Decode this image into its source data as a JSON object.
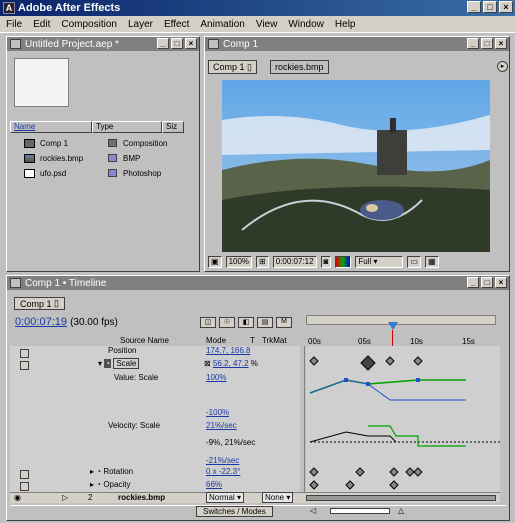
{
  "app": {
    "title": "Adobe After Effects"
  },
  "menu": [
    "File",
    "Edit",
    "Composition",
    "Layer",
    "Effect",
    "Animation",
    "View",
    "Window",
    "Help"
  ],
  "project": {
    "title": "Untitled Project.aep *",
    "columns": [
      "Name",
      "Type",
      "Siz"
    ],
    "items": [
      {
        "name": "Comp 1",
        "type": "Composition",
        "icon": "composition-icon",
        "color": "#707070"
      },
      {
        "name": "rockies.bmp",
        "type": "BMP",
        "icon": "footage-icon",
        "color": "#8888d0"
      },
      {
        "name": "ufo.psd",
        "type": "Photoshop",
        "icon": "psd-icon",
        "color": "#8888d0"
      }
    ]
  },
  "comp": {
    "title": "Comp 1",
    "tabs": [
      "Comp 1",
      "rockies.bmp"
    ],
    "zoom": "100%",
    "timecode": "0:00:07:12",
    "resolution": "Full"
  },
  "timeline": {
    "title": "Comp 1 • Timeline",
    "tab": "Comp 1",
    "timecode": "0:00:07:19",
    "fps": "(30.00 fps)",
    "headers": {
      "source": "Source Name",
      "mode": "Mode",
      "t": "T",
      "trkmat": "TrkMat"
    },
    "ruler": [
      "00s",
      "05s",
      "10s",
      "15s"
    ],
    "properties": {
      "position": {
        "label": "Position",
        "value": "174.7, 166.8"
      },
      "scale": {
        "label": "Scale",
        "value": "56.2, 47.2",
        "unit": "%"
      },
      "value_scale": {
        "label": "Value: Scale",
        "top": "100%",
        "bottom": "-100%"
      },
      "velocity_scale": {
        "label": "Velocity: Scale",
        "top": "21%/sec",
        "mid": "-9%, 21%/sec",
        "bottom": "-21%/sec"
      },
      "rotation": {
        "label": "Rotation",
        "value": "0 x -22.3°"
      },
      "opacity": {
        "label": "Opacity",
        "value": "66%"
      }
    },
    "layer2": {
      "num": "2",
      "name": "rockies.bmp",
      "mode": "Normal",
      "trkmat": "None"
    },
    "footer": "Switches / Modes"
  },
  "colors": {
    "title_blue": "#0a246a",
    "panel_gray": "#c0c0c0",
    "link_blue": "#1a3aa5",
    "graph_green": "#00a000",
    "graph_blue": "#2050d0"
  }
}
